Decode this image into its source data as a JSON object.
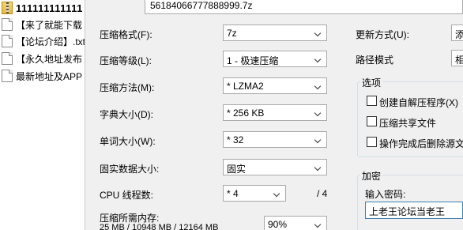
{
  "explorer": {
    "items": [
      {
        "name": "111111111111",
        "icon": "archive-icon"
      },
      {
        "name": "【来了就能下载",
        "icon": "document-icon"
      },
      {
        "name": "【论坛介绍】.txt",
        "icon": "document-icon"
      },
      {
        "name": "【永久地址发布",
        "icon": "document-icon"
      },
      {
        "name": "最新地址及APP",
        "icon": "document-icon"
      }
    ]
  },
  "dialog": {
    "archive_name": "56184066777888999.7z",
    "format": {
      "label": "压缩格式(F):",
      "value": "7z"
    },
    "level": {
      "label": "压缩等级(L):",
      "value": "1 - 极速压缩"
    },
    "method": {
      "label": "压缩方法(M):",
      "value": "* LZMA2"
    },
    "dict": {
      "label": "字典大小(D):",
      "value": "* 256 KB"
    },
    "word": {
      "label": "单词大小(W):",
      "value": "* 32"
    },
    "solid": {
      "label": "固实数据大小:",
      "value": "固实"
    },
    "cpu": {
      "label": "CPU 线程数:",
      "value": "* 4",
      "max": "/ 4"
    },
    "memory": {
      "label": "压缩所需内存:",
      "detail": "25 MB / 10948 MB / 12164 MB",
      "percent": "90%"
    },
    "update_mode": {
      "label": "更新方式(U):",
      "value": "添"
    },
    "path_mode": {
      "label": "路径模式",
      "value": "相"
    },
    "options": {
      "title": "选项",
      "sfx": "创建自解压程序(X)",
      "shared": "压缩共享文件",
      "delete": "操作完成后删除源文"
    },
    "encryption": {
      "title": "加密",
      "password_label": "输入密码:",
      "password_value": "上老王论坛当老王"
    }
  }
}
